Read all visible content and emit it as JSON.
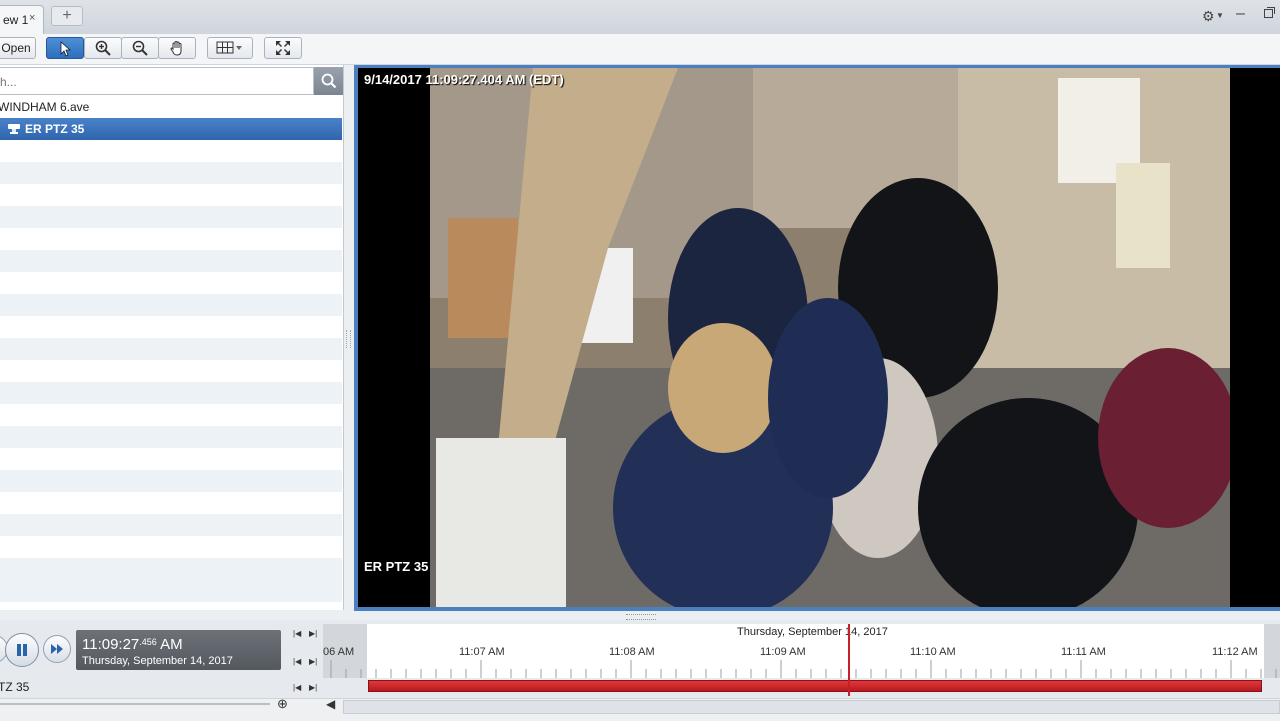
{
  "tabs": [
    {
      "label": "ew 1",
      "close": "×"
    }
  ],
  "tab_add": "+",
  "window_controls": {
    "settings_icon": "gear-icon",
    "minimize": "–",
    "restore_icon": "restore-icon"
  },
  "toolbar": {
    "open_label": "Open",
    "select_icon": "pointer-icon",
    "zoom_in_icon": "zoom-in-icon",
    "zoom_out_icon": "zoom-out-icon",
    "pan_icon": "hand-icon",
    "layout_icon": "grid-layout-icon",
    "fullscreen_icon": "fullscreen-icon"
  },
  "sidebar": {
    "search": {
      "placeholder": "ch..."
    },
    "tree": [
      {
        "label": "WINDHAM 6.ave",
        "selected": false
      },
      {
        "label": "ER PTZ 35",
        "selected": true,
        "icon": "ptz-camera-icon"
      }
    ]
  },
  "video": {
    "timestamp": "9/14/2017 11:09:27.404 AM (EDT)",
    "camera_label": "ER PTZ 35"
  },
  "playback": {
    "time": "11:09:27",
    "time_ms": ".456",
    "ampm": "AM",
    "date": "Thursday, September 14, 2017"
  },
  "timeline": {
    "date_header": "Thursday, September 14, 2017",
    "labels": [
      "06 AM",
      "11:07 AM",
      "11:08 AM",
      "11:09 AM",
      "11:10 AM",
      "11:11 AM",
      "11:12 AM"
    ],
    "track_label": "TZ 35",
    "colors": {
      "recording": "#c8202a",
      "selection": "#2f65ad"
    }
  }
}
